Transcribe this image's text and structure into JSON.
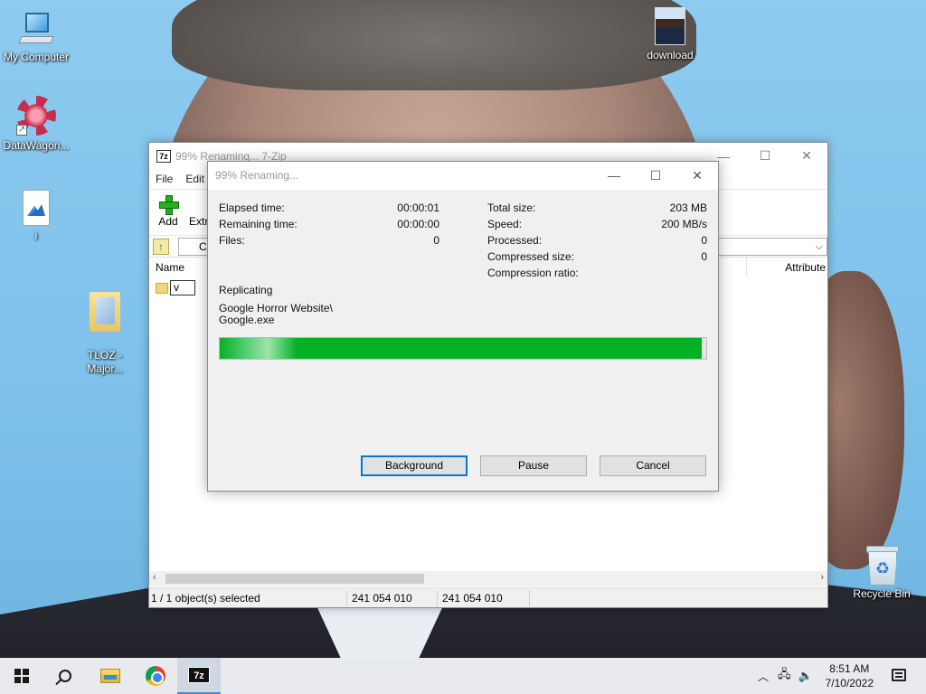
{
  "desktop": {
    "icons": [
      {
        "label": "My Computer"
      },
      {
        "label": "DataWagon..."
      },
      {
        "label": "i"
      },
      {
        "label": "TLOZ -\nMajor..."
      },
      {
        "label": "download"
      },
      {
        "label": "Recycle Bin"
      }
    ]
  },
  "main_window": {
    "title": "99% Renaming... 7-Zip",
    "menu": [
      "File",
      "Edit"
    ],
    "toolbar": {
      "add_label": "Add",
      "extract_label": "Extr"
    },
    "address_prefix": "C",
    "columns": {
      "name": "Name",
      "attributes": "Attribute"
    },
    "rename_value": "v",
    "status": {
      "selected": "1 / 1 object(s) selected",
      "size": "241 054 010",
      "packed": "241 054 010"
    }
  },
  "dialog": {
    "title": "99% Renaming...",
    "left_stats": [
      {
        "label": "Elapsed time:",
        "value": "00:00:01"
      },
      {
        "label": "Remaining time:",
        "value": "00:00:00"
      },
      {
        "label": "Files:",
        "value": "0"
      }
    ],
    "right_stats": [
      {
        "label": "Total size:",
        "value": "203 MB"
      },
      {
        "label": "Speed:",
        "value": "200 MB/s"
      },
      {
        "label": "Processed:",
        "value": "0"
      },
      {
        "label": "Compressed size:",
        "value": "0"
      },
      {
        "label": "Compression ratio:",
        "value": ""
      }
    ],
    "operation": "Replicating",
    "path_line1": "Google Horror Website\\",
    "path_line2": "Google.exe",
    "progress": 0.99,
    "progress_color": "#06b025",
    "buttons": {
      "background": "Background",
      "pause": "Pause",
      "cancel": "Cancel"
    }
  },
  "taskbar": {
    "time": "8:51 AM",
    "date": "7/10/2022",
    "apps": [
      "start-icon",
      "search-icon",
      "file-explorer-icon",
      "chrome-icon",
      "7zip-icon"
    ]
  }
}
